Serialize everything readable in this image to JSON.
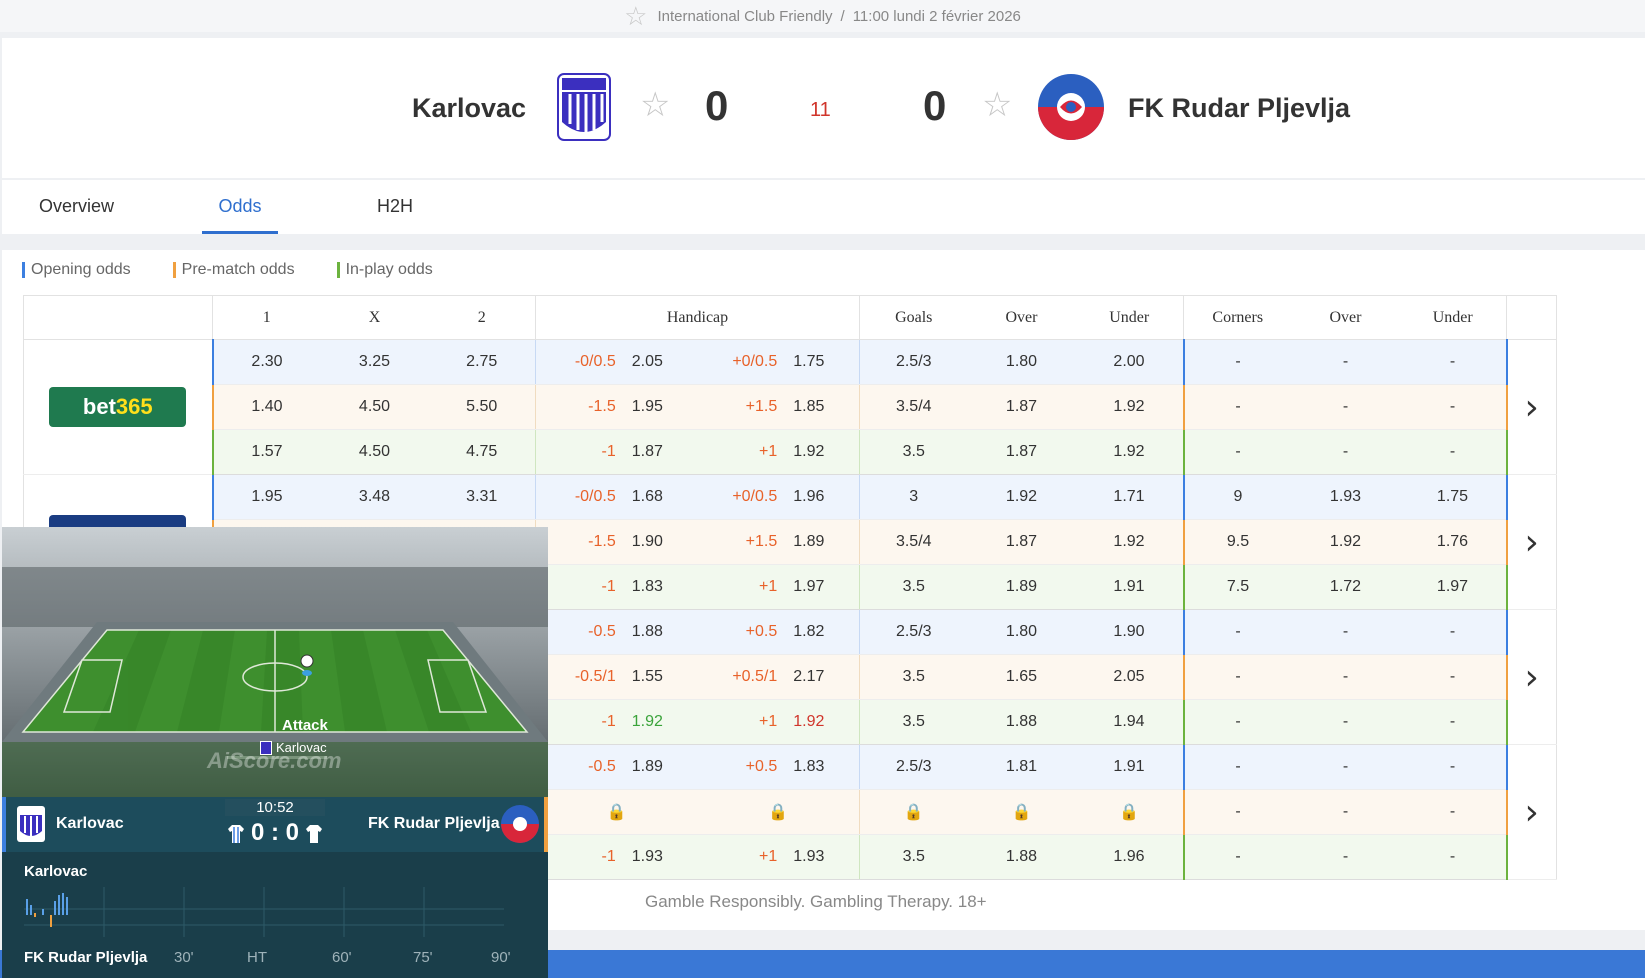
{
  "match": {
    "competition": "International Club Friendly",
    "kickoff": "11:00 lundi 2 février 2026",
    "home_team": "Karlovac",
    "away_team": "FK Rudar Pljevlja",
    "home_score": "0",
    "away_score": "0",
    "minute": "11"
  },
  "tabs": [
    "Overview",
    "Odds",
    "H2H"
  ],
  "active_tab": "Odds",
  "legend": {
    "opening": "Opening odds",
    "prematch": "Pre-match odds",
    "inplay": "In-play odds",
    "colors": {
      "opening": "#3c7fe0",
      "prematch": "#f0a040",
      "inplay": "#6cb33e"
    }
  },
  "columns": {
    "c1": "1",
    "cx": "X",
    "c2": "2",
    "handicap": "Handicap",
    "goals": "Goals",
    "goals_over": "Over",
    "goals_under": "Under",
    "corners": "Corners",
    "corners_over": "Over",
    "corners_under": "Under"
  },
  "bookmakers": [
    {
      "name": "bet365",
      "rows": [
        {
          "type": "open",
          "o1": "2.30",
          "ox": "3.25",
          "o2": "2.75",
          "hA": "-0/0.5",
          "hAo": "2.05",
          "hB": "+0/0.5",
          "hBo": "1.75",
          "g": "2.5/3",
          "go": "1.80",
          "gu": "2.00",
          "c": "-",
          "co": "-",
          "cu": "-"
        },
        {
          "type": "pre",
          "o1": "1.40",
          "ox": "4.50",
          "o2": "5.50",
          "hA": "-1.5",
          "hAo": "1.95",
          "hB": "+1.5",
          "hBo": "1.85",
          "g": "3.5/4",
          "go": "1.87",
          "gu": "1.92",
          "c": "-",
          "co": "-",
          "cu": "-"
        },
        {
          "type": "live",
          "o1": "1.57",
          "ox": "4.50",
          "o2": "4.75",
          "hA": "-1",
          "hAo": "1.87",
          "hB": "+1",
          "hBo": "1.92",
          "g": "3.5",
          "go": "1.87",
          "gu": "1.92",
          "c": "-",
          "co": "-",
          "cu": "-"
        }
      ]
    },
    {
      "name": "",
      "rows": [
        {
          "type": "open",
          "o1": "1.95",
          "ox": "3.48",
          "o2": "3.31",
          "hA": "-0/0.5",
          "hAo": "1.68",
          "hB": "+0/0.5",
          "hBo": "1.96",
          "g": "3",
          "go": "1.92",
          "gu": "1.71",
          "c": "9",
          "co": "1.93",
          "cu": "1.75"
        },
        {
          "type": "pre",
          "o1": "",
          "ox": "",
          "o2": "",
          "hA": "-1.5",
          "hAo": "1.90",
          "hB": "+1.5",
          "hBo": "1.89",
          "g": "3.5/4",
          "go": "1.87",
          "gu": "1.92",
          "c": "9.5",
          "co": "1.92",
          "cu": "1.76"
        },
        {
          "type": "live",
          "o1": "",
          "ox": "",
          "o2": "",
          "hA": "-1",
          "hAo": "1.83",
          "hB": "+1",
          "hBo": "1.97",
          "g": "3.5",
          "go": "1.89",
          "gu": "1.91",
          "c": "7.5",
          "co": "1.72",
          "cu": "1.97"
        }
      ]
    },
    {
      "name": "",
      "rows": [
        {
          "type": "open",
          "o1": "",
          "ox": "",
          "o2": "",
          "hA": "-0.5",
          "hAo": "1.88",
          "hB": "+0.5",
          "hBo": "1.82",
          "g": "2.5/3",
          "go": "1.80",
          "gu": "1.90",
          "c": "-",
          "co": "-",
          "cu": "-"
        },
        {
          "type": "pre",
          "o1": "",
          "ox": "",
          "o2": "",
          "hA": "-0.5/1",
          "hAo": "1.55",
          "hB": "+0.5/1",
          "hBo": "2.17",
          "g": "3.5",
          "go": "1.65",
          "gu": "2.05",
          "c": "-",
          "co": "-",
          "cu": "-"
        },
        {
          "type": "live",
          "o1": "",
          "ox": "",
          "o2": "",
          "hA": "-1",
          "hAo": "1.92",
          "hB": "+1",
          "hBo": "1.92",
          "g": "3.5",
          "go": "1.88",
          "gu": "1.94",
          "c": "-",
          "co": "-",
          "cu": "-",
          "hAo_color": "green",
          "hBo_color": "red",
          "go_color": "green",
          "gu_color": "red",
          "co_color": "green",
          "cu_color": "red"
        }
      ]
    },
    {
      "name": "",
      "rows": [
        {
          "type": "open",
          "o1": "",
          "ox": "",
          "o2": "",
          "hA": "-0.5",
          "hAo": "1.89",
          "hB": "+0.5",
          "hBo": "1.83",
          "g": "2.5/3",
          "go": "1.81",
          "gu": "1.91",
          "c": "-",
          "co": "-",
          "cu": "-"
        },
        {
          "type": "pre",
          "locked": true,
          "c": "-",
          "co": "-",
          "cu": "-"
        },
        {
          "type": "live",
          "o1": "",
          "ox": "",
          "o2": "",
          "hA": "-1",
          "hAo": "1.93",
          "hB": "+1",
          "hBo": "1.93",
          "g": "3.5",
          "go": "1.88",
          "gu": "1.96",
          "c": "-",
          "co": "-",
          "cu": "-"
        }
      ]
    }
  ],
  "footer": {
    "gamble": "Gamble Responsibly. Gambling Therapy. 18+"
  },
  "widget": {
    "event": "Attack",
    "possession_team": "Karlovac",
    "watermark": "AiScore.com",
    "ad_board": "AiScore.com",
    "clock": "10:52",
    "home": "Karlovac",
    "away": "FK Rudar Pljevlja",
    "score": "0 : 0",
    "timeline_ticks": [
      "30'",
      "HT",
      "60'",
      "75'",
      "90'"
    ]
  },
  "icons": {
    "favorite": "star-icon",
    "next": "chevron-right-icon",
    "lock": "lock-icon"
  }
}
